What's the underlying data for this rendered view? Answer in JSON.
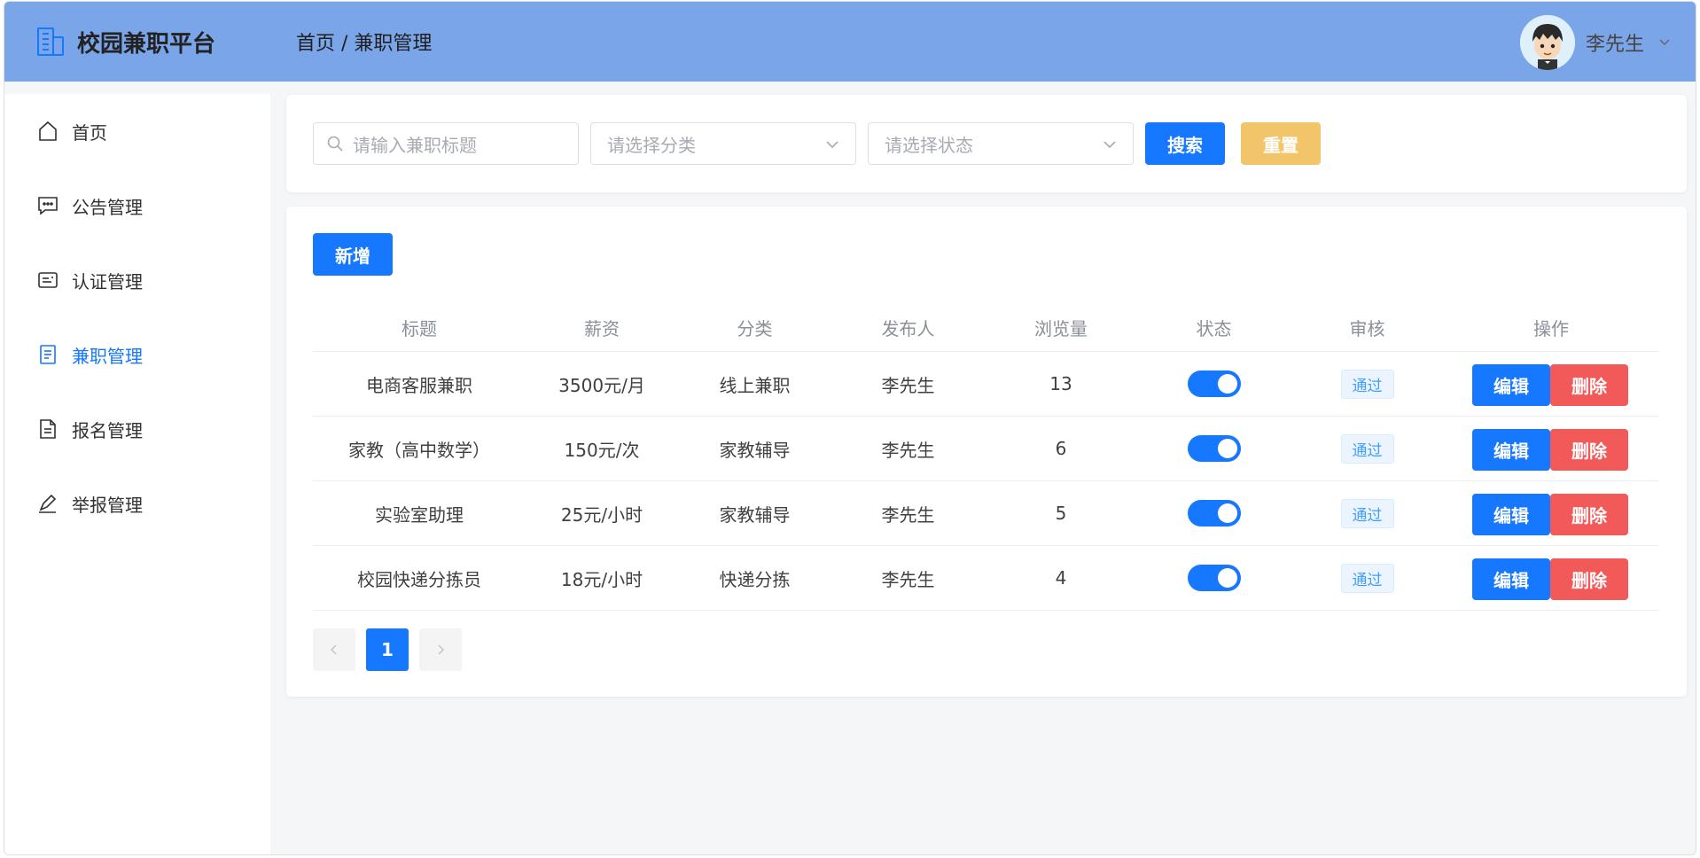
{
  "header": {
    "app_title": "校园兼职平台",
    "breadcrumb": "首页 / 兼职管理",
    "user_name": "李先生"
  },
  "sidebar": {
    "items": [
      {
        "label": "首页",
        "icon": "home-icon",
        "active": false
      },
      {
        "label": "公告管理",
        "icon": "message-icon",
        "active": false
      },
      {
        "label": "认证管理",
        "icon": "id-card-icon",
        "active": false
      },
      {
        "label": "兼职管理",
        "icon": "document-icon",
        "active": true
      },
      {
        "label": "报名管理",
        "icon": "file-icon",
        "active": false
      },
      {
        "label": "举报管理",
        "icon": "edit-pen-icon",
        "active": false
      }
    ]
  },
  "search": {
    "title_placeholder": "请输入兼职标题",
    "category_placeholder": "请选择分类",
    "status_placeholder": "请选择状态",
    "search_label": "搜索",
    "reset_label": "重置"
  },
  "table": {
    "add_label": "新增",
    "columns": [
      "标题",
      "薪资",
      "分类",
      "发布人",
      "浏览量",
      "状态",
      "审核",
      "操作"
    ],
    "rows": [
      {
        "title": "电商客服兼职",
        "salary": "3500元/月",
        "category": "线上兼职",
        "publisher": "李先生",
        "views": "13",
        "enabled": true,
        "review": "通过"
      },
      {
        "title": "家教（高中数学）",
        "salary": "150元/次",
        "category": "家教辅导",
        "publisher": "李先生",
        "views": "6",
        "enabled": true,
        "review": "通过"
      },
      {
        "title": "实验室助理",
        "salary": "25元/小时",
        "category": "家教辅导",
        "publisher": "李先生",
        "views": "5",
        "enabled": true,
        "review": "通过"
      },
      {
        "title": "校园快递分拣员",
        "salary": "18元/小时",
        "category": "快递分拣",
        "publisher": "李先生",
        "views": "4",
        "enabled": true,
        "review": "通过"
      }
    ],
    "edit_label": "编辑",
    "delete_label": "删除"
  },
  "pagination": {
    "current_page": "1"
  },
  "colors": {
    "header": "#7ba5e9",
    "primary": "#1677ff",
    "warning": "#f3c56b",
    "danger": "#f25a5a"
  }
}
